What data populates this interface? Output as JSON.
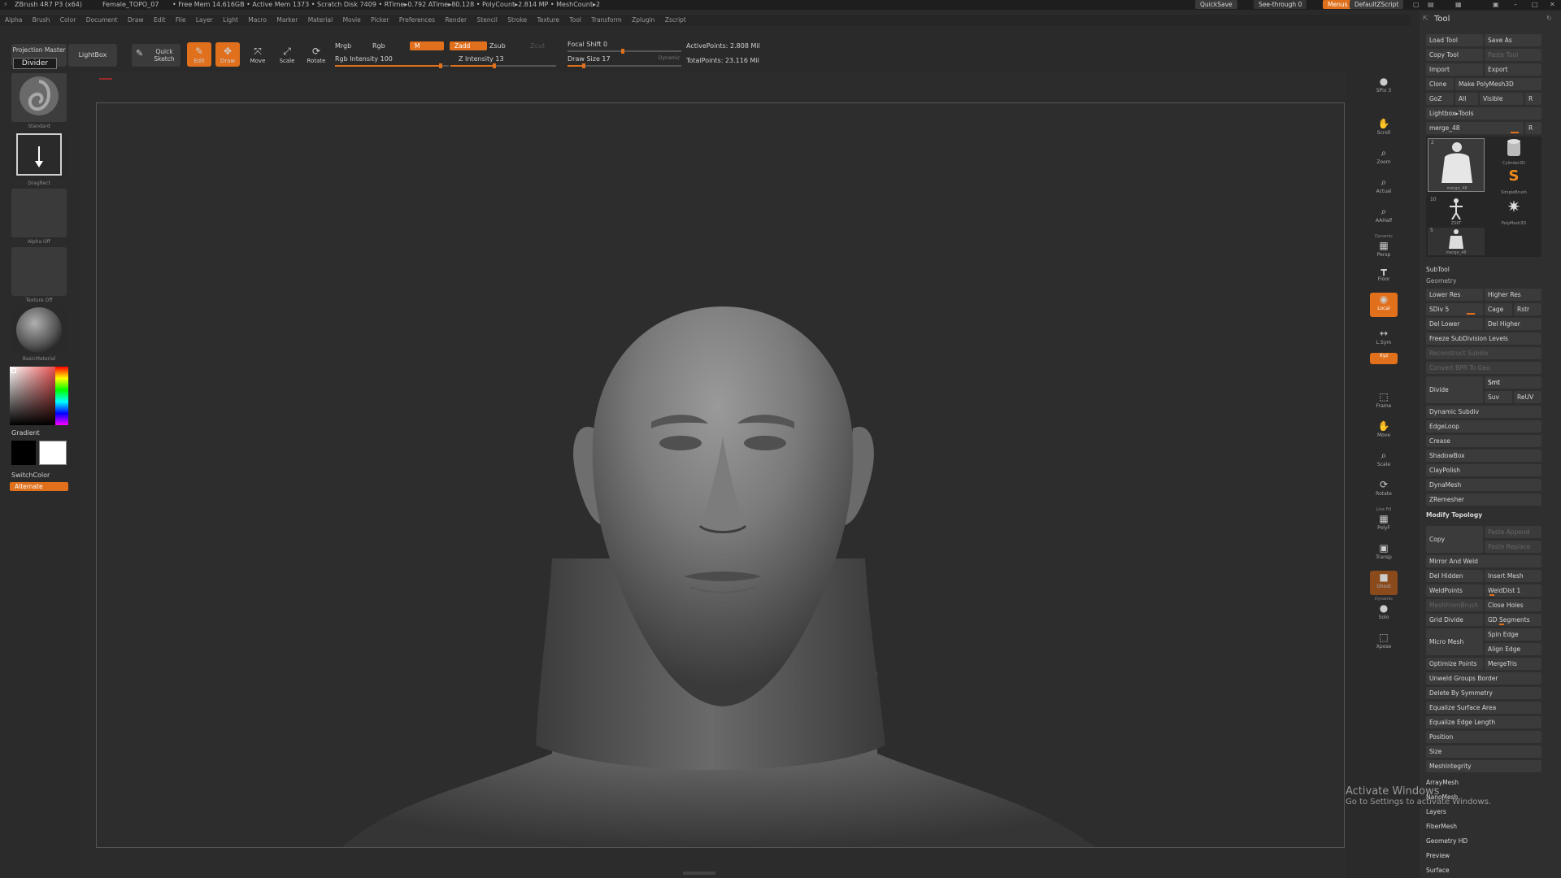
{
  "title_bar": {
    "app": "ZBrush 4R7 P3 (x64)",
    "file": "Female_TOPO_07",
    "stats": "• Free Mem 14.616GB • Active Mem 1373 • Scratch Disk 7409 • RTime▸0.792 ATime▸80.128 • PolyCount▸2.814 MP • MeshCount▸2",
    "quicksave": "QuickSave",
    "see_through": "See-through",
    "see_through_value": "0",
    "menus": "Menus",
    "script": "DefaultZScript"
  },
  "menubar": [
    "Alpha",
    "Brush",
    "Color",
    "Document",
    "Draw",
    "Edit",
    "File",
    "Layer",
    "Light",
    "Macro",
    "Marker",
    "Material",
    "Movie",
    "Picker",
    "Preferences",
    "Render",
    "Stencil",
    "Stroke",
    "Texture",
    "Tool",
    "Transform",
    "Zplugin",
    "Zscript"
  ],
  "toolbar": {
    "projection_master": "Projection Master",
    "divider": "Divider",
    "lightbox": "LightBox",
    "quick_sketch": "Quick Sketch",
    "edit": "Edit",
    "draw": "Draw",
    "move": "Move",
    "scale": "Scale",
    "rotate": "Rotate",
    "mrgb": "Mrgb",
    "rgb": "Rgb",
    "m": "M",
    "rgb_intensity": "Rgb Intensity 100",
    "zadd": "Zadd",
    "zsub": "Zsub",
    "zcut": "Zcut",
    "z_intensity": "Z Intensity 13",
    "focal_shift": "Focal Shift 0",
    "draw_size": "Draw Size 17",
    "dynamic": "Dynamic",
    "active_points": "ActivePoints: 2.808 Mil",
    "total_points": "TotalPoints: 23.116 Mil"
  },
  "left_shelf": {
    "brush": "Standard",
    "stroke": "DragRect",
    "alpha": "Alpha Off",
    "texture": "Texture Off",
    "material": "BasicMaterial",
    "gradient": "Gradient",
    "switch_color": "SwitchColor",
    "alternate": "Alternate"
  },
  "right_strip": [
    {
      "label": "SPix 3",
      "glyph": "●",
      "icon": "spix-icon"
    },
    {
      "label": "Scroll",
      "glyph": "✋",
      "icon": "scroll-icon"
    },
    {
      "label": "Zoom",
      "glyph": "⌕",
      "icon": "zoom-icon"
    },
    {
      "label": "Actual",
      "glyph": "⌕",
      "icon": "actual-icon"
    },
    {
      "label": "AAHalf",
      "glyph": "⌕",
      "icon": "aahalf-icon"
    },
    {
      "label": "Persp",
      "glyph": "▦",
      "icon": "persp-icon"
    },
    {
      "label": "Floor",
      "glyph": "┳",
      "icon": "floor-icon"
    },
    {
      "label": "Local",
      "glyph": "◉",
      "icon": "local-icon"
    },
    {
      "label": "L.Sym",
      "glyph": "↔",
      "icon": "lsym-icon"
    },
    {
      "label": "Xyz",
      "glyph": "⬌",
      "icon": "xyz-icon"
    },
    {
      "label": "Frame",
      "glyph": "⬚",
      "icon": "frame-icon"
    },
    {
      "label": "Move",
      "glyph": "✋",
      "icon": "move-icon"
    },
    {
      "label": "Scale",
      "glyph": "⌕",
      "icon": "scale-icon"
    },
    {
      "label": "Rotate",
      "glyph": "⟳",
      "icon": "rotate-icon"
    },
    {
      "label": "PolyF",
      "glyph": "▦",
      "icon": "polyf-icon"
    },
    {
      "label": "Transp",
      "glyph": "▣",
      "icon": "transp-icon"
    },
    {
      "label": "Ghost",
      "glyph": "■",
      "icon": "ghost-icon"
    },
    {
      "label": "Solo",
      "glyph": "●",
      "icon": "solo-icon"
    },
    {
      "label": "Xpose",
      "glyph": "⬚",
      "icon": "xpose-icon"
    }
  ],
  "right_strip_extra": {
    "line_fill": "Line Fill",
    "dynamic": "Dynamic"
  },
  "palette": {
    "title": "Tool",
    "load_tool": "Load Tool",
    "save_as": "Save As",
    "copy_tool": "Copy Tool",
    "paste_tool": "Paste Tool",
    "import": "Import",
    "export": "Export",
    "clone": "Clone",
    "make_polymesh": "Make PolyMesh3D",
    "goz": "GoZ",
    "all": "All",
    "visible": "Visible",
    "r": "R",
    "lightbox_tools": "Lightbox▸Tools",
    "merge_label": "merge_48",
    "thumbs": [
      {
        "name": "merge_48",
        "count": "2"
      },
      {
        "name": "Cylinder3D",
        "count": ""
      },
      {
        "name": "SimpleBrush",
        "count": ""
      },
      {
        "name": "ZSKT",
        "count": "10"
      },
      {
        "name": "PolyMesh3D",
        "count": ""
      },
      {
        "name": "merge_48",
        "count": "5"
      }
    ],
    "subtool": "SubTool",
    "geometry": "Geometry",
    "lower_res": "Lower Res",
    "higher_res": "Higher Res",
    "sdiv": "SDiv 5",
    "cage": "Cage",
    "rstr": "Rstr",
    "del_lower": "Del Lower",
    "del_higher": "Del Higher",
    "freeze": "Freeze SubDivision Levels",
    "reconstruct": "Reconstruct Subdiv",
    "convert_bpr": "Convert BPR To Geo",
    "divide": "Divide",
    "smt": "Smt",
    "suv": "Suv",
    "reuv": "ReUV",
    "dynamic_subdiv": "Dynamic Subdiv",
    "edgeloop": "EdgeLoop",
    "crease": "Crease",
    "shadowbox": "ShadowBox",
    "claypolish": "ClayPolish",
    "dynamesh": "DynaMesh",
    "zremesher": "ZRemesher",
    "modify_topology": "Modify Topology",
    "copy": "Copy",
    "paste_append": "Paste Append",
    "paste_replace": "Paste Replace",
    "mirror_weld": "Mirror And Weld",
    "del_hidden": "Del Hidden",
    "insert_mesh": "Insert Mesh",
    "weldpoints": "WeldPoints",
    "welddist": "WeldDist 1",
    "meshfrombrush": "MeshFromBrush",
    "close_holes": "Close Holes",
    "grid_divide": "Grid Divide",
    "gd_segments": "GD Segments",
    "micro_mesh": "Micro Mesh",
    "spin_edge": "Spin Edge",
    "align_edge": "Align Edge",
    "optimize_points": "Optimize Points",
    "mergetris": "MergeTris",
    "unweld_groups": "Unweld Groups Border",
    "delete_symmetry": "Delete By Symmetry",
    "equalize_surface": "Equalize Surface Area",
    "equalize_edge": "Equalize Edge Length",
    "position": "Position",
    "size": "Size",
    "meshintegrity": "MeshIntegrity",
    "arraymesh": "ArrayMesh",
    "nanomesh": "NanoMesh",
    "layers": "Layers",
    "fibermesh": "FiberMesh",
    "geometry_hd": "Geometry HD",
    "preview": "Preview",
    "surface": "Surface"
  },
  "watermark": {
    "line1": "Activate Windows",
    "line2": "Go to Settings to activate Windows."
  },
  "colors": {
    "accent": "#e0701c",
    "background": "#2a2a2a",
    "panel": "#2f2f2f"
  }
}
